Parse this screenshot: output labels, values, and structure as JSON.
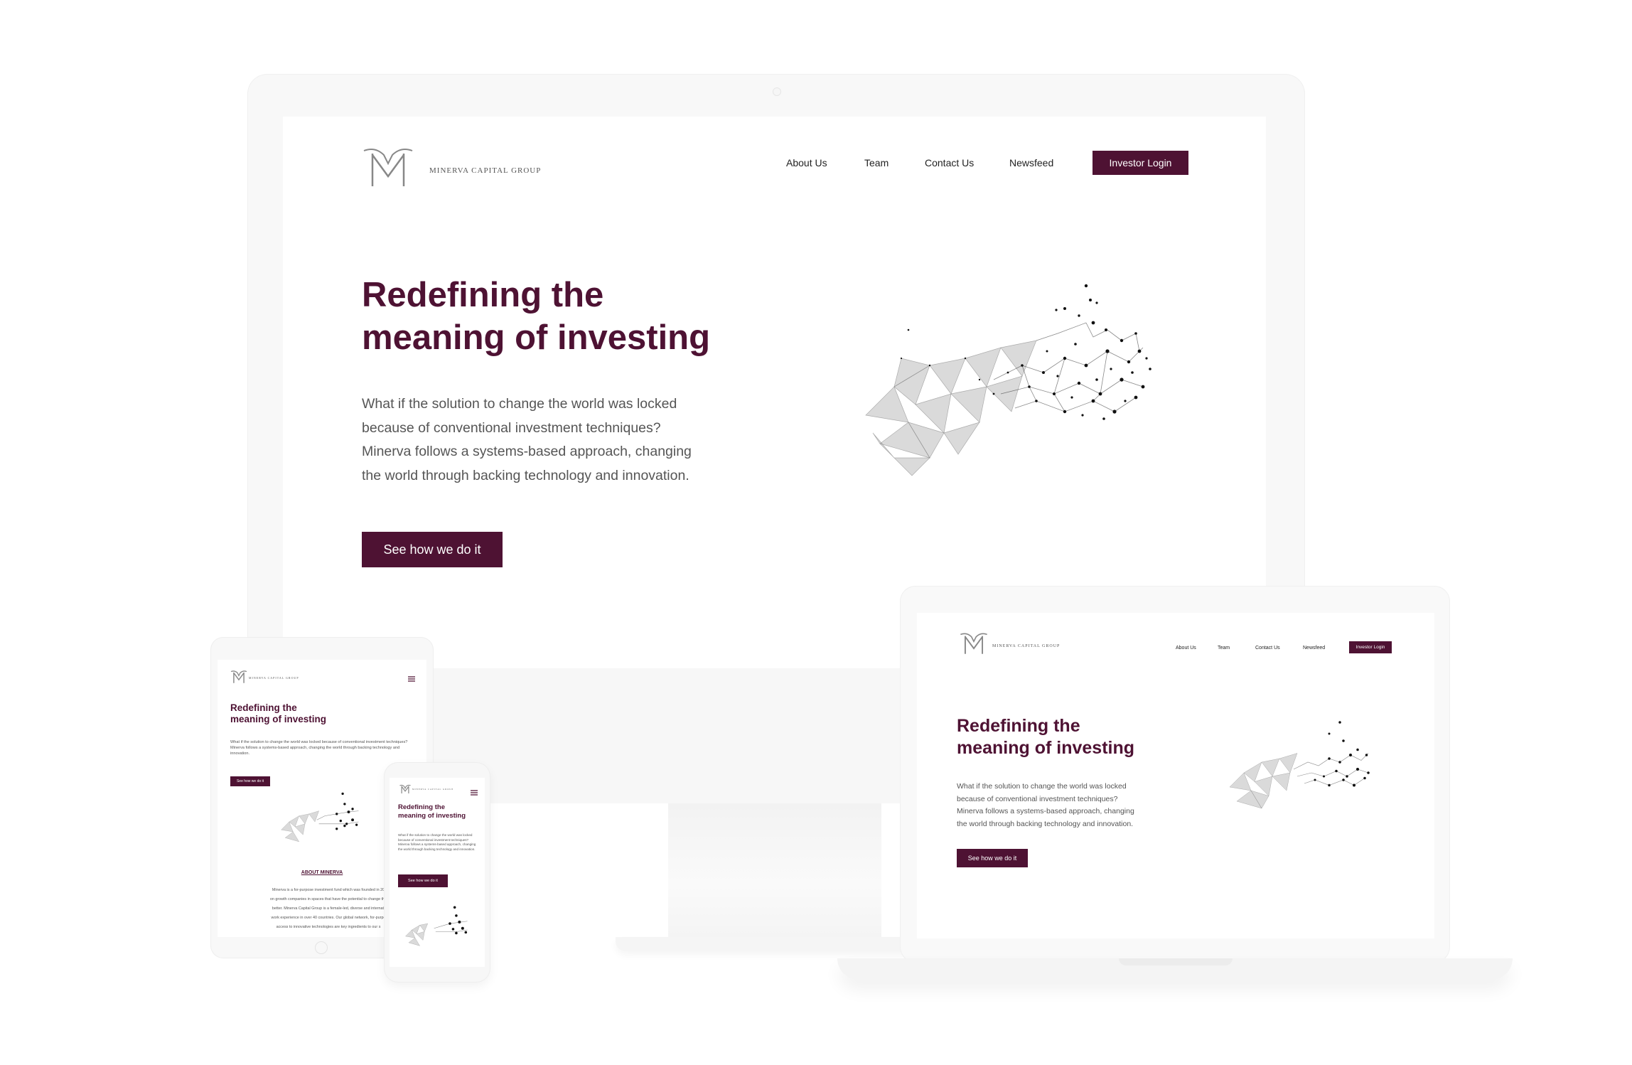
{
  "brand": {
    "name": "MINERVA CAPITAL GROUP"
  },
  "nav": {
    "items": [
      "About Us",
      "Team",
      "Contact Us",
      "Newsfeed"
    ],
    "login_label": "Investor Login"
  },
  "hero": {
    "title_line1": "Redefining the",
    "title_line2": "meaning of investing",
    "body_line1": "What if the solution to change the world was locked",
    "body_line2": "because of conventional investment techniques?",
    "body_line3": "Minerva follows a systems-based approach, changing",
    "body_line4": "the world through backing technology and innovation.",
    "cta_label": "See how we do it"
  },
  "tablet": {
    "body": "What if the solution to change the world was locked because of conventional investment techniques? Minerva follows a systems-based approach, changing the world through backing technology and innovation.",
    "about_heading": "ABOUT MINERVA",
    "about_line1": "Minerva is a for-purpose investment fund which was founded in 20",
    "about_line2": "on growth companies in spaces that have the potential to change the",
    "about_line3": "better. Minerva Capital Group is a female-led, diverse and internati",
    "about_line4": "work experience in over 40 countries. Our global network, for-purpo",
    "about_line5": "access to innovative technologies are key ingredients to our s"
  },
  "phone": {
    "body": "What if the solution to change the world was locked because of conventional investment techniques? Minerva follows a systems-based approach, changing the world through backing technology and innovation."
  },
  "colors": {
    "accent": "#4e1233",
    "frame": "#f8f8f8",
    "text": "#555555"
  },
  "icons": {
    "menu": "hamburger-icon",
    "logo": "minerva-m-logo-icon"
  }
}
